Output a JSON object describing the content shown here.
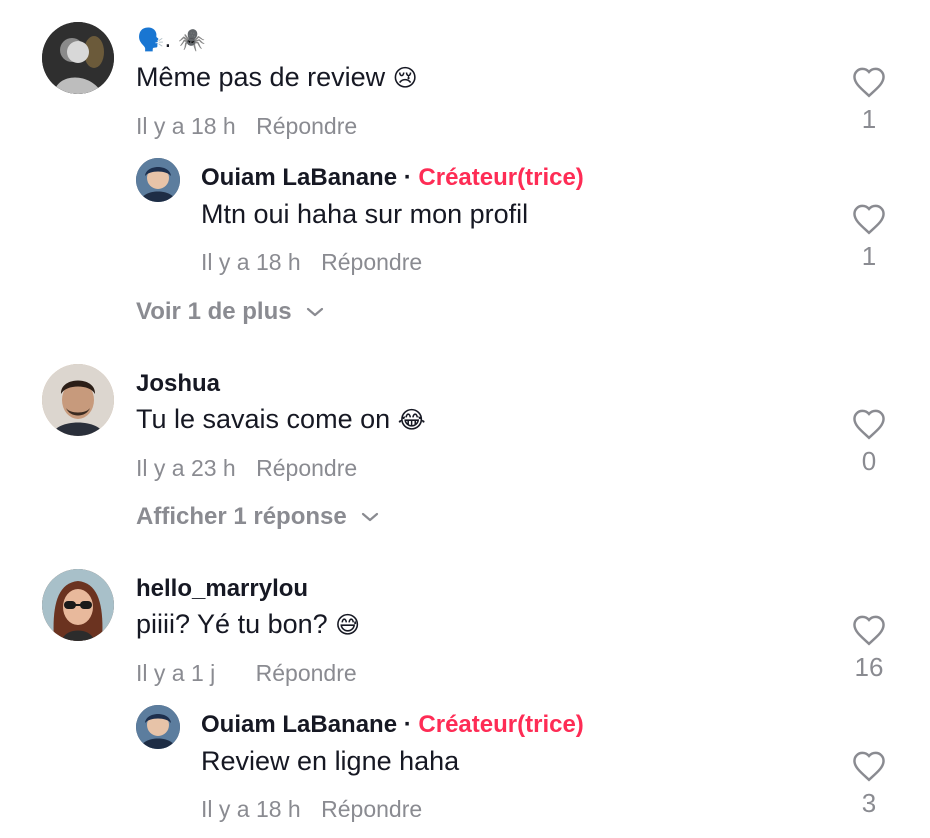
{
  "comments": [
    {
      "username": "🗣️. 🕷️",
      "text": "Même pas de review",
      "emoji": "😢",
      "time": "Il y a 18 h",
      "reply": "Répondre",
      "likes": "1",
      "icon": "heart-outline-icon"
    },
    {
      "username": "Ouiam LaBanane",
      "separator": "·",
      "badge": "Créateur(trice)",
      "text": "Mtn oui haha sur mon profil",
      "time": "Il y a 18 h",
      "reply": "Répondre",
      "likes": "1"
    },
    {
      "more": "Voir 1 de plus"
    },
    {
      "username": "Joshua",
      "text": "Tu le savais come on",
      "emoji": "😂",
      "time": "Il y a 23 h",
      "reply": "Répondre",
      "likes": "0"
    },
    {
      "more": "Afficher 1 réponse"
    },
    {
      "username": "hello_marrylou",
      "text": "piiii? Yé tu bon?",
      "emoji": "😅",
      "time": "Il y a 1 j",
      "reply": "Répondre",
      "likes": "16"
    },
    {
      "username": "Ouiam LaBanane",
      "separator": "·",
      "badge": "Créateur(trice)",
      "text": "Review en ligne haha",
      "time": "Il y a 18 h",
      "reply": "Répondre",
      "likes": "3"
    }
  ],
  "colors": {
    "text": "#161823",
    "muted": "#8a8b91",
    "creator": "#fe2c55"
  }
}
